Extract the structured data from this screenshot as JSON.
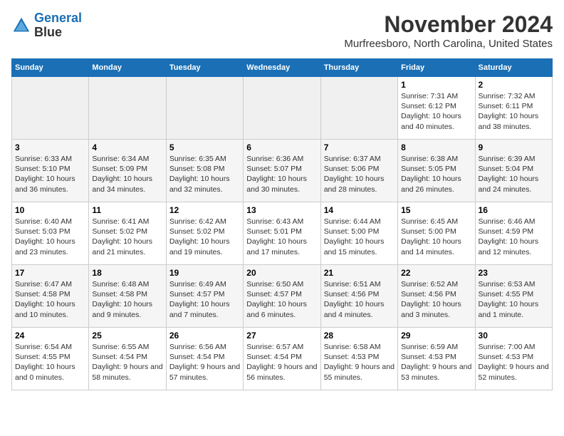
{
  "logo": {
    "line1": "General",
    "line2": "Blue"
  },
  "title": "November 2024",
  "subtitle": "Murfreesboro, North Carolina, United States",
  "days_of_week": [
    "Sunday",
    "Monday",
    "Tuesday",
    "Wednesday",
    "Thursday",
    "Friday",
    "Saturday"
  ],
  "weeks": [
    [
      {
        "day": "",
        "info": ""
      },
      {
        "day": "",
        "info": ""
      },
      {
        "day": "",
        "info": ""
      },
      {
        "day": "",
        "info": ""
      },
      {
        "day": "",
        "info": ""
      },
      {
        "day": "1",
        "info": "Sunrise: 7:31 AM\nSunset: 6:12 PM\nDaylight: 10 hours and 40 minutes."
      },
      {
        "day": "2",
        "info": "Sunrise: 7:32 AM\nSunset: 6:11 PM\nDaylight: 10 hours and 38 minutes."
      }
    ],
    [
      {
        "day": "3",
        "info": "Sunrise: 6:33 AM\nSunset: 5:10 PM\nDaylight: 10 hours and 36 minutes."
      },
      {
        "day": "4",
        "info": "Sunrise: 6:34 AM\nSunset: 5:09 PM\nDaylight: 10 hours and 34 minutes."
      },
      {
        "day": "5",
        "info": "Sunrise: 6:35 AM\nSunset: 5:08 PM\nDaylight: 10 hours and 32 minutes."
      },
      {
        "day": "6",
        "info": "Sunrise: 6:36 AM\nSunset: 5:07 PM\nDaylight: 10 hours and 30 minutes."
      },
      {
        "day": "7",
        "info": "Sunrise: 6:37 AM\nSunset: 5:06 PM\nDaylight: 10 hours and 28 minutes."
      },
      {
        "day": "8",
        "info": "Sunrise: 6:38 AM\nSunset: 5:05 PM\nDaylight: 10 hours and 26 minutes."
      },
      {
        "day": "9",
        "info": "Sunrise: 6:39 AM\nSunset: 5:04 PM\nDaylight: 10 hours and 24 minutes."
      }
    ],
    [
      {
        "day": "10",
        "info": "Sunrise: 6:40 AM\nSunset: 5:03 PM\nDaylight: 10 hours and 23 minutes."
      },
      {
        "day": "11",
        "info": "Sunrise: 6:41 AM\nSunset: 5:02 PM\nDaylight: 10 hours and 21 minutes."
      },
      {
        "day": "12",
        "info": "Sunrise: 6:42 AM\nSunset: 5:02 PM\nDaylight: 10 hours and 19 minutes."
      },
      {
        "day": "13",
        "info": "Sunrise: 6:43 AM\nSunset: 5:01 PM\nDaylight: 10 hours and 17 minutes."
      },
      {
        "day": "14",
        "info": "Sunrise: 6:44 AM\nSunset: 5:00 PM\nDaylight: 10 hours and 15 minutes."
      },
      {
        "day": "15",
        "info": "Sunrise: 6:45 AM\nSunset: 5:00 PM\nDaylight: 10 hours and 14 minutes."
      },
      {
        "day": "16",
        "info": "Sunrise: 6:46 AM\nSunset: 4:59 PM\nDaylight: 10 hours and 12 minutes."
      }
    ],
    [
      {
        "day": "17",
        "info": "Sunrise: 6:47 AM\nSunset: 4:58 PM\nDaylight: 10 hours and 10 minutes."
      },
      {
        "day": "18",
        "info": "Sunrise: 6:48 AM\nSunset: 4:58 PM\nDaylight: 10 hours and 9 minutes."
      },
      {
        "day": "19",
        "info": "Sunrise: 6:49 AM\nSunset: 4:57 PM\nDaylight: 10 hours and 7 minutes."
      },
      {
        "day": "20",
        "info": "Sunrise: 6:50 AM\nSunset: 4:57 PM\nDaylight: 10 hours and 6 minutes."
      },
      {
        "day": "21",
        "info": "Sunrise: 6:51 AM\nSunset: 4:56 PM\nDaylight: 10 hours and 4 minutes."
      },
      {
        "day": "22",
        "info": "Sunrise: 6:52 AM\nSunset: 4:56 PM\nDaylight: 10 hours and 3 minutes."
      },
      {
        "day": "23",
        "info": "Sunrise: 6:53 AM\nSunset: 4:55 PM\nDaylight: 10 hours and 1 minute."
      }
    ],
    [
      {
        "day": "24",
        "info": "Sunrise: 6:54 AM\nSunset: 4:55 PM\nDaylight: 10 hours and 0 minutes."
      },
      {
        "day": "25",
        "info": "Sunrise: 6:55 AM\nSunset: 4:54 PM\nDaylight: 9 hours and 58 minutes."
      },
      {
        "day": "26",
        "info": "Sunrise: 6:56 AM\nSunset: 4:54 PM\nDaylight: 9 hours and 57 minutes."
      },
      {
        "day": "27",
        "info": "Sunrise: 6:57 AM\nSunset: 4:54 PM\nDaylight: 9 hours and 56 minutes."
      },
      {
        "day": "28",
        "info": "Sunrise: 6:58 AM\nSunset: 4:53 PM\nDaylight: 9 hours and 55 minutes."
      },
      {
        "day": "29",
        "info": "Sunrise: 6:59 AM\nSunset: 4:53 PM\nDaylight: 9 hours and 53 minutes."
      },
      {
        "day": "30",
        "info": "Sunrise: 7:00 AM\nSunset: 4:53 PM\nDaylight: 9 hours and 52 minutes."
      }
    ]
  ]
}
